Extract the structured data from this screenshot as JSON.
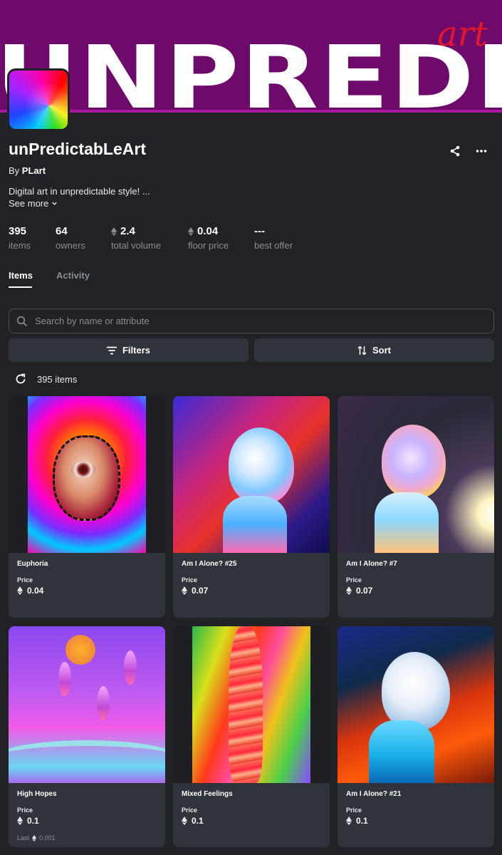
{
  "banner": {
    "text": "UNPREDIC",
    "tag": "art"
  },
  "collection": {
    "title": "unPredictabLeArt",
    "by_prefix": "By",
    "creator": "PLart",
    "description": "Digital art in unpredictable style! ...",
    "see_more": "See more"
  },
  "stats": [
    {
      "value": "395",
      "label": "items",
      "eth": false
    },
    {
      "value": "64",
      "label": "owners",
      "eth": false
    },
    {
      "value": "2.4",
      "label": "total volume",
      "eth": true
    },
    {
      "value": "0.04",
      "label": "floor price",
      "eth": true
    },
    {
      "value": "---",
      "label": "best offer",
      "eth": false
    }
  ],
  "tabs": [
    {
      "label": "Items",
      "active": true
    },
    {
      "label": "Activity",
      "active": false
    }
  ],
  "search": {
    "placeholder": "Search by name or attribute",
    "value": ""
  },
  "toolbar": {
    "filters_label": "Filters",
    "sort_label": "Sort"
  },
  "results": {
    "count_text": "395 items"
  },
  "cards": [
    {
      "name": "Euphoria",
      "price_label": "Price",
      "price": "0.04"
    },
    {
      "name": "Am I Alone? #25",
      "price_label": "Price",
      "price": "0.07"
    },
    {
      "name": "Am I Alone? #7",
      "price_label": "Price",
      "price": "0.07"
    },
    {
      "name": "High Hopes",
      "price_label": "Price",
      "price": "0.1",
      "last_label": "Last",
      "last_price": "0.001"
    },
    {
      "name": "Mixed Feelings",
      "price_label": "Price",
      "price": "0.1"
    },
    {
      "name": "Am I Alone? #21",
      "price_label": "Price",
      "price": "0.1"
    }
  ],
  "icons": [
    "share-icon",
    "more-icon",
    "chevron-down-icon",
    "eth-icon",
    "search-icon",
    "filter-icon",
    "sort-icon",
    "refresh-icon"
  ],
  "colors": {
    "background": "#202225",
    "card": "#303339",
    "banner": "#6f0a6d",
    "muted_text": "#8a8d93"
  }
}
